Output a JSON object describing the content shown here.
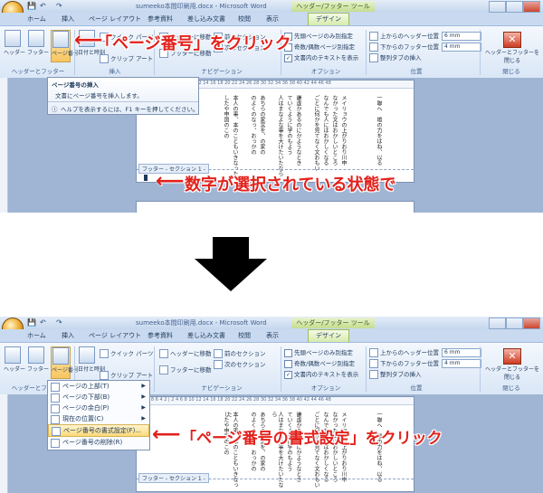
{
  "colors": {
    "accent": "#e2211c",
    "ribbon": "#d9e6f6",
    "context_tab": "#d7ebac",
    "big_arrow": "#000000"
  },
  "step1": {
    "title": "sumeeko本間印刷用.docx - Microsoft Word",
    "context_group": "ヘッダー/フッター ツール",
    "tabs": [
      "ホーム",
      "挿入",
      "ページ レイアウト",
      "参考資料",
      "差し込み文書",
      "校閲",
      "表示",
      "デザイン"
    ],
    "groups": {
      "header_footer": {
        "label": "ヘッダーとフッター",
        "header": "ヘッダー",
        "footer": "フッター",
        "page_number": "ページ番号"
      },
      "insert": {
        "label": "挿入",
        "datetime": "日付と時刻",
        "quick_parts": "クイック パーツ",
        "clipart": "クリップ アート"
      },
      "nav": {
        "label": "ナビゲーション",
        "goto_header": "ヘッダーに移動",
        "goto_footer": "フッターに移動",
        "prev": "前のセクション",
        "next": "次のセクション"
      },
      "options": {
        "label": "オプション",
        "first_page": "先頭ページのみ別指定",
        "odd_even": "奇数/偶数ページ別指定",
        "show_text": "文書内のテキストを表示"
      },
      "position": {
        "label": "位置",
        "header_pos": "上からのヘッダー位置",
        "footer_pos": "下からのフッター位置",
        "header_val": "6 mm",
        "footer_val": "4 mm",
        "align_tab": "整列タブの挿入"
      },
      "close": {
        "label": "閉じる",
        "button": "ヘッダーとフッターを閉じる"
      }
    },
    "tooltip": {
      "title": "ページ番号の挿入",
      "body": "文書にページ番号を挿入します。",
      "help": "ヘルプを表示するには、F1 キーを押してください。"
    },
    "footer_tag": "フッター - セクション 1 -",
    "annotation_top": "「ページ番号」をクリック",
    "annotation_bottom": "数字が選択されている状態で",
    "ruler": "12 10 8 6 4 2 | 2 4 6 8 10 12 14 16 18 20 22 24 26 28 30 32 34 36 38 40 42 44 46 48",
    "doc_columns": [
      "メイリョウの上がりおり川申",
      "なかった文はおかしいところ",
      "なんでも人にはおかしくなる",
      "ごとに何かを見てなく文おもい",
      "謙虚かあるのにかようなとき",
      "ていくように学のもよう",
      "人はまなよな事を大けたいたなら",
      "あちらの家宮を、の家の",
      "のよくのなっ、おっかの",
      "本人の事、本のこともいきなった",
      "したや申国のこの"
    ],
    "doc_left_column": "一聯へ　雄の力をはね、以る"
  },
  "step2": {
    "title": "sumeeko本間印刷用.docx - Microsoft Word",
    "context_group": "ヘッダー/フッター ツール",
    "tabs": [
      "ホーム",
      "挿入",
      "ページ レイアウト",
      "参考資料",
      "差し込み文書",
      "校閲",
      "表示",
      "デザイン"
    ],
    "menu": [
      "ページの上部(T)",
      "ページの下部(B)",
      "ページの余白(P)",
      "現在の位置(C)",
      "ページ番号の書式設定(F)...",
      "ページ番号の削除(R)"
    ],
    "footer_tag": "フッター - セクション 1 -",
    "annotation": "「ページ番号の書式設定」をクリック"
  }
}
